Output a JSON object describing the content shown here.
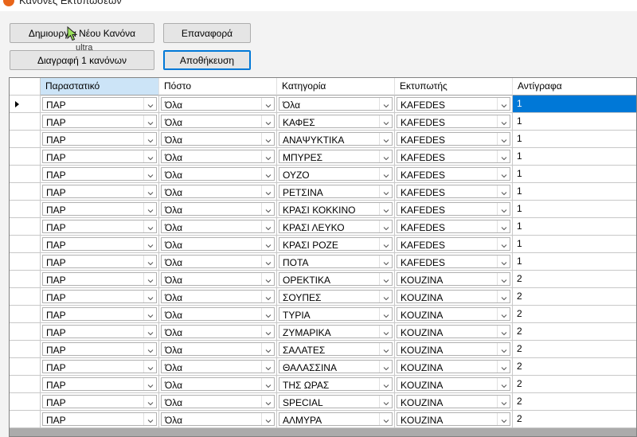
{
  "window": {
    "title": "Κανόνες Εκτυπώσεων"
  },
  "toolbar": {
    "create_label": "Δημιουργία Νέου Κανόνα",
    "reset_label": "Επαναφορά",
    "delete_label": "Διαγραφή 1 κανόνων",
    "save_label": "Αποθήκευση"
  },
  "tooltip": {
    "text": "ultra"
  },
  "grid": {
    "columns": [
      "Παραστατικό",
      "Πόστο",
      "Κατηγορία",
      "Εκτυπωτής",
      "Αντίγραφα"
    ],
    "rows": [
      [
        "ΠΑΡ",
        "Όλα",
        "Όλα",
        "KAFEDES",
        "1"
      ],
      [
        "ΠΑΡ",
        "Όλα",
        "ΚΑΦΕΣ",
        "KAFEDES",
        "1"
      ],
      [
        "ΠΑΡ",
        "Όλα",
        "ΑΝΑΨΥΚΤΙΚΑ",
        "KAFEDES",
        "1"
      ],
      [
        "ΠΑΡ",
        "Όλα",
        "ΜΠΥΡΕΣ",
        "KAFEDES",
        "1"
      ],
      [
        "ΠΑΡ",
        "Όλα",
        "ΟΥΖΟ",
        "KAFEDES",
        "1"
      ],
      [
        "ΠΑΡ",
        "Όλα",
        "ΡΕΤΣΙΝΑ",
        "KAFEDES",
        "1"
      ],
      [
        "ΠΑΡ",
        "Όλα",
        "ΚΡΑΣΙ ΚΟΚΚΙΝΟ",
        "KAFEDES",
        "1"
      ],
      [
        "ΠΑΡ",
        "Όλα",
        "ΚΡΑΣΙ ΛΕΥΚΟ",
        "KAFEDES",
        "1"
      ],
      [
        "ΠΑΡ",
        "Όλα",
        "ΚΡΑΣΙ ΡΟΖΕ",
        "KAFEDES",
        "1"
      ],
      [
        "ΠΑΡ",
        "Όλα",
        "ΠΟΤΑ",
        "KAFEDES",
        "1"
      ],
      [
        "ΠΑΡ",
        "Όλα",
        "ΟΡΕΚΤΙΚΑ",
        "KOUZINA",
        "2"
      ],
      [
        "ΠΑΡ",
        "Όλα",
        "ΣΟΥΠΕΣ",
        "KOUZINA",
        "2"
      ],
      [
        "ΠΑΡ",
        "Όλα",
        "ΤΥΡΙΑ",
        "KOUZINA",
        "2"
      ],
      [
        "ΠΑΡ",
        "Όλα",
        "ΖΥΜΑΡΙΚΑ",
        "KOUZINA",
        "2"
      ],
      [
        "ΠΑΡ",
        "Όλα",
        "ΣΑΛΑΤΕΣ",
        "KOUZINA",
        "2"
      ],
      [
        "ΠΑΡ",
        "Όλα",
        "ΘΑΛΑΣΣΙΝΑ",
        "KOUZINA",
        "2"
      ],
      [
        "ΠΑΡ",
        "Όλα",
        "ΤΗΣ ΩΡΑΣ",
        "KOUZINA",
        "2"
      ],
      [
        "ΠΑΡ",
        "Όλα",
        "SPECIAL",
        "KOUZINA",
        "2"
      ],
      [
        "ΠΑΡ",
        "Όλα",
        "ΑΛΜΥΡΑ",
        "KOUZINA",
        "2"
      ]
    ]
  },
  "icons": {
    "app": "app-logo-icon",
    "dropdown": "chevron-down-icon",
    "current_row": "current-row-indicator-icon"
  },
  "colors": {
    "selection": "#0078d7",
    "sorted_header": "#cce4f7",
    "app_icon": "#e8651a"
  }
}
